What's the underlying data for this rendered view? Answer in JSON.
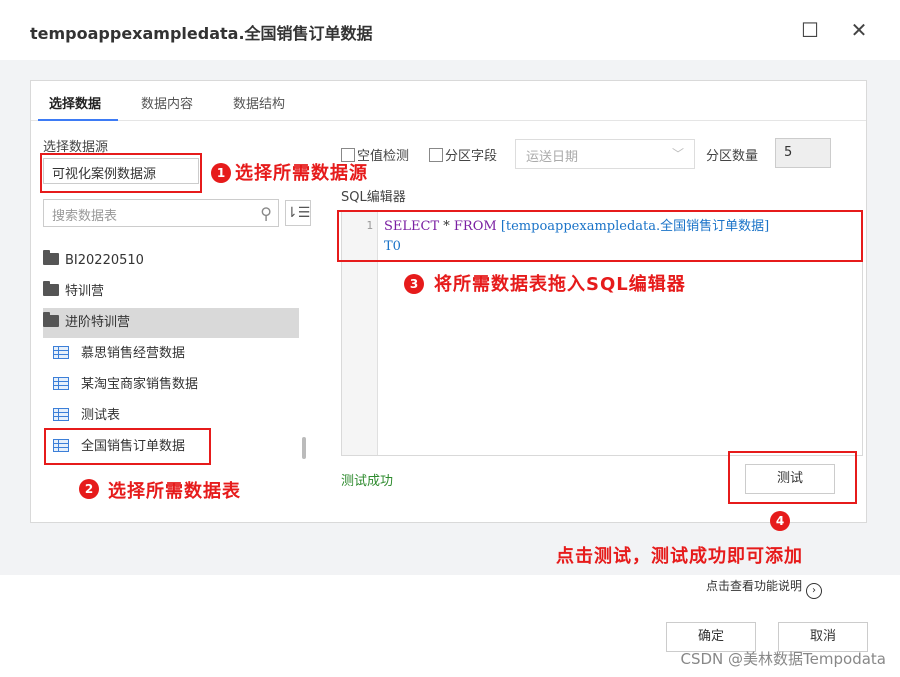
{
  "window": {
    "title": "tempoappexampledata.全国销售订单数据",
    "maximize_glyph": "☐",
    "close_glyph": "✕"
  },
  "tabs": [
    {
      "label": "选择数据",
      "active": true
    },
    {
      "label": "数据内容",
      "active": false
    },
    {
      "label": "数据结构",
      "active": false
    }
  ],
  "left": {
    "source_label": "选择数据源",
    "source_value": "可视化案例数据源",
    "search_placeholder": "搜索数据表",
    "search_icon": "magnifier-icon",
    "sort_icon": "sort-icon",
    "tree": [
      {
        "type": "folder",
        "label": "BI20220510",
        "selected": false
      },
      {
        "type": "folder",
        "label": "特训营",
        "selected": false
      },
      {
        "type": "folder",
        "label": "进阶特训营",
        "selected": true
      },
      {
        "type": "table",
        "label": "慕思销售经营数据",
        "selected": false
      },
      {
        "type": "table",
        "label": "某淘宝商家销售数据",
        "selected": false
      },
      {
        "type": "table",
        "label": "测试表",
        "selected": false
      },
      {
        "type": "table",
        "label": "全国销售订单数据",
        "selected": false
      }
    ]
  },
  "right": {
    "null_check_label": "空值检测",
    "partition_field_label": "分区字段",
    "partition_field_value": "运送日期",
    "partition_count_label": "分区数量",
    "partition_count_value": "5",
    "sql_editor_label": "SQL编辑器",
    "line_number": "1",
    "sql_keyword_select": "SELECT",
    "sql_star": " * ",
    "sql_keyword_from": "FROM",
    "sql_table": " [tempoappexampledata.全国销售订单数据]",
    "sql_alias": "T0",
    "test_status": "测试成功",
    "test_button": "测试"
  },
  "footer": {
    "help_link": "点击查看功能说明",
    "confirm": "确定",
    "cancel": "取消"
  },
  "annotations": {
    "step1_num": "1",
    "step1": "选择所需数据源",
    "step2_num": "2",
    "step2": "选择所需数据表",
    "step3_num": "3",
    "step3": "将所需数据表拖入SQL编辑器",
    "step4_num": "4",
    "step4": "点击测试，测试成功即可添加",
    "color": "#e61b1b"
  },
  "watermark": "CSDN @美林数据Tempodata"
}
